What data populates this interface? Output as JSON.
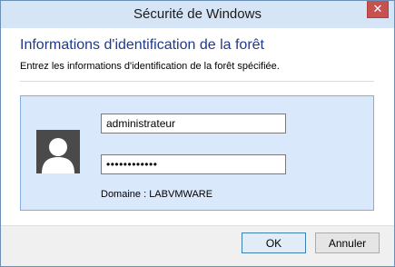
{
  "window": {
    "title": "Sécurité de Windows",
    "close_glyph": "✕"
  },
  "header": {
    "title": "Informations d'identification de la forêt",
    "subtitle": "Entrez les informations d'identification de la forêt spécifiée."
  },
  "credentials": {
    "username_value": "administrateur",
    "password_value": "••••••••••••",
    "domain_text": "Domaine : LABVMWARE",
    "avatar_icon": "user-silhouette-icon"
  },
  "buttons": {
    "ok_label": "OK",
    "cancel_label": "Annuler"
  },
  "colors": {
    "titlebar": "#d6e5f5",
    "heading": "#1f3a8a",
    "tile_background": "#dae8fc",
    "tile_border": "#84acdd",
    "close_button": "#c75050"
  }
}
